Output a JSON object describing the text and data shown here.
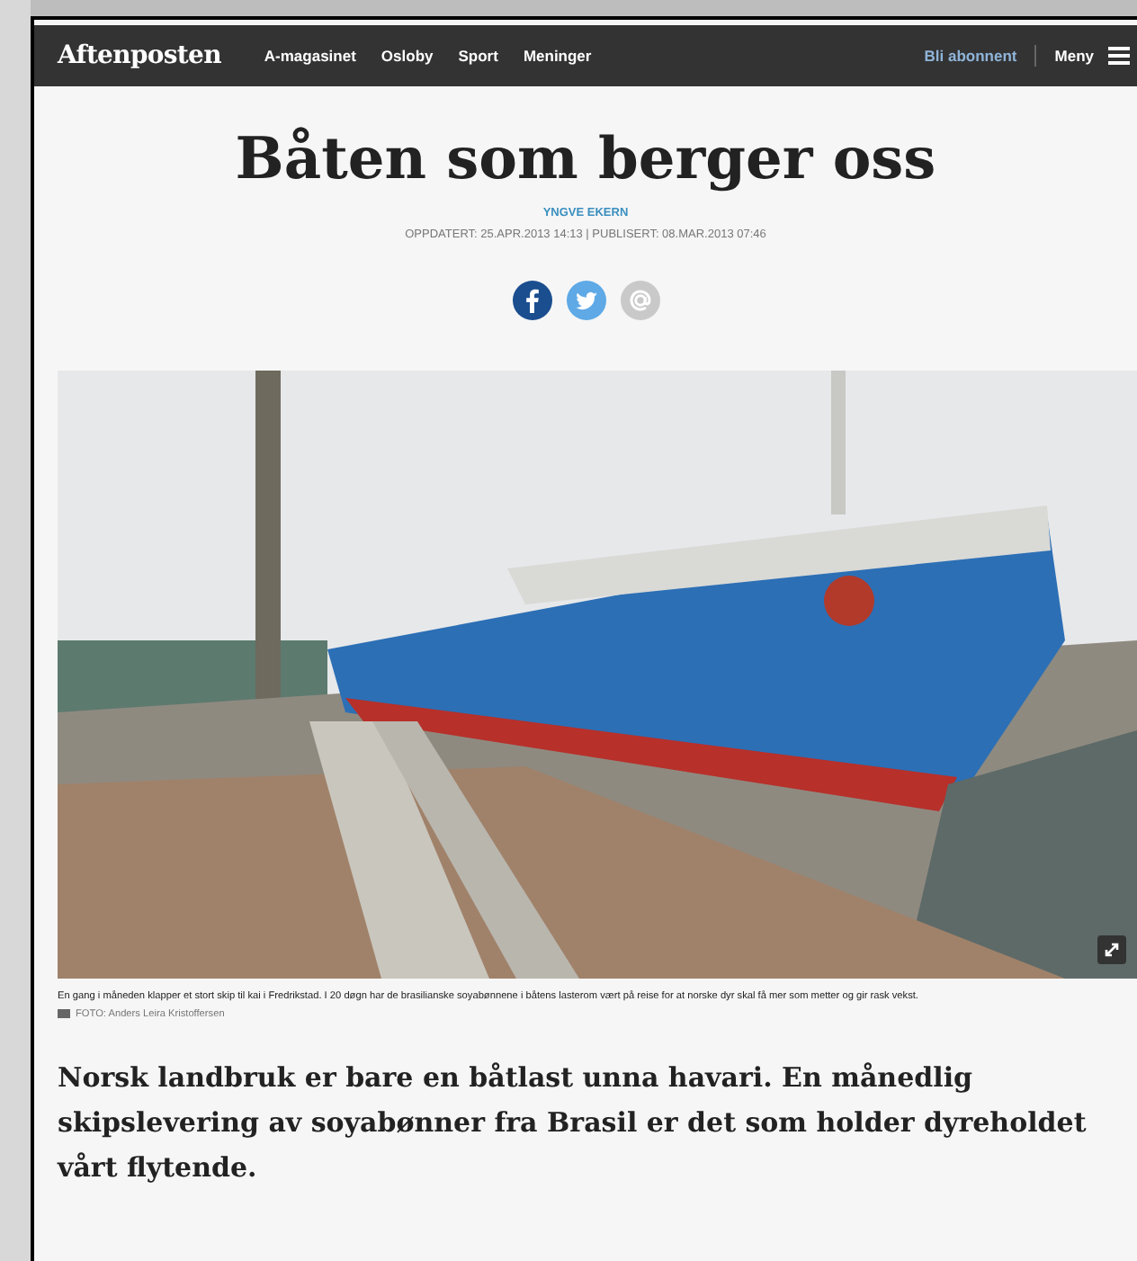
{
  "header": {
    "logo": "Aftenposten",
    "nav": [
      "A-magasinet",
      "Osloby",
      "Sport",
      "Meninger"
    ],
    "subscribe": "Bli abonnent",
    "menu": "Meny"
  },
  "article": {
    "title": "Båten som berger oss",
    "byline": "YNGVE EKERN",
    "dates": "OPPDATERT: 25.APR.2013 14:13 | PUBLISERT: 08.MAR.2013 07:46",
    "share": [
      {
        "kind": "facebook"
      },
      {
        "kind": "twitter"
      },
      {
        "kind": "email"
      }
    ],
    "caption": "En gang i måneden klapper et stort skip til kai i Fredrikstad. I 20 døgn har de brasilianske soyabønnene i båtens lasterom vært på reise for at norske dyr skal få mer som metter og gir rask vekst.",
    "credit": "FOTO: Anders Leira Kristoffersen",
    "lead": "Norsk landbruk er bare en båtlast unna havari. En månedlig skipslevering av soyabønner fra Brasil er det som holder dyreholdet vårt flytende."
  }
}
